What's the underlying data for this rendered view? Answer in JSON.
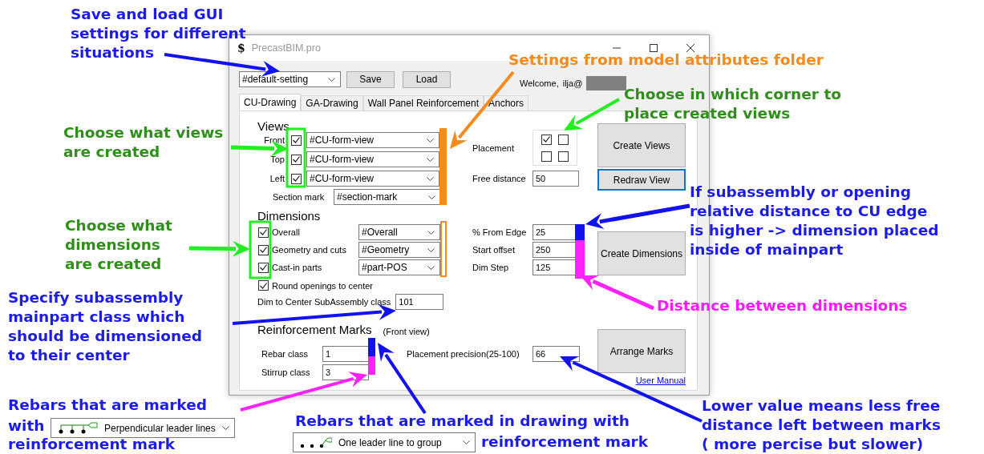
{
  "window": {
    "icon": "$",
    "title": "PrecastBIM.pro"
  },
  "toolbar": {
    "setting": "#default-setting",
    "buttons": [
      "Save",
      "Load"
    ],
    "welcome": "Welcome,",
    "user": "ilja@"
  },
  "tabs": [
    {
      "label": "CU-Drawing",
      "selected": true
    },
    {
      "label": "GA-Drawing",
      "selected": false
    },
    {
      "label": "Wall Panel Reinforcement",
      "selected": false
    },
    {
      "label": "Anchors",
      "selected": false
    }
  ],
  "views": {
    "heading": "Views",
    "rows": [
      {
        "label": "Front",
        "checked": true,
        "value": "#CU-form-view"
      },
      {
        "label": "Top",
        "checked": true,
        "value": "#CU-form-view"
      },
      {
        "label": "Left",
        "checked": true,
        "value": "#CU-form-view"
      }
    ],
    "section_mark": {
      "label": "Section mark",
      "value": "#section-mark"
    },
    "placement": {
      "label": "Placement",
      "corners": [
        {
          "checked": true
        },
        {
          "checked": false
        },
        {
          "checked": false
        },
        {
          "checked": false
        }
      ]
    },
    "free_distance": {
      "label": "Free distance",
      "value": "50"
    },
    "buttons": [
      {
        "label": "Create Views",
        "focused": false
      },
      {
        "label": "Redraw View",
        "focused": true
      }
    ]
  },
  "dimensions": {
    "heading": "Dimensions",
    "rows": [
      {
        "label": "Overall",
        "checked": true,
        "value": "#Overall"
      },
      {
        "label": "Geometry and cuts",
        "checked": true,
        "value": "#Geometry"
      },
      {
        "label": "Cast-in parts",
        "checked": true,
        "value": "#part-POS"
      }
    ],
    "round_openings": {
      "label": "Round openings to center",
      "checked": true
    },
    "dim_to_center": {
      "label": "Dim to Center SubAssembly class",
      "value": "101"
    },
    "fields": [
      {
        "label": "% From Edge",
        "value": "25"
      },
      {
        "label": "Start offset",
        "value": "250"
      },
      {
        "label": "Dim Step",
        "value": "125"
      }
    ],
    "button": "Create Dimensions"
  },
  "reinforcement": {
    "heading": "Reinforcement Marks",
    "note": "(Front view)",
    "fields": [
      {
        "label": "Rebar class",
        "value": "1"
      },
      {
        "label": "Stirrup class",
        "value": "3"
      }
    ],
    "precision": {
      "label": "Placement precision(25-100)",
      "value": "66"
    },
    "button": "Arrange Marks",
    "link": "User Manual"
  },
  "annotations": [
    {
      "kind": "text",
      "color": "#1c1ce6",
      "lines": [
        "Save and load GUI",
        "settings for different",
        "situations"
      ]
    },
    {
      "kind": "text",
      "color": "#f58a1f",
      "lines": [
        "Settings from model attributes folder"
      ]
    },
    {
      "kind": "text",
      "color": "#2f8f1a",
      "lines": [
        "Choose in which corner to",
        "place created views"
      ]
    },
    {
      "kind": "text",
      "color": "#2f8f1a",
      "lines": [
        "Choose what views",
        "are created"
      ]
    },
    {
      "kind": "text",
      "color": "#2f8f1a",
      "lines": [
        "Choose what",
        "dimensions",
        "are created"
      ]
    },
    {
      "kind": "text",
      "color": "#1c1ce6",
      "lines": [
        "If subassembly or opening",
        "relative distance to CU edge",
        "is higher -> dimension placed",
        "inside of mainpart"
      ]
    },
    {
      "kind": "text",
      "color": "#ff1aff",
      "lines": [
        "Distance between dimensions"
      ]
    },
    {
      "kind": "text",
      "color": "#1c1ce6",
      "lines": [
        "Specify subassembly",
        "mainpart class which",
        "should be dimensioned",
        "to their center"
      ]
    },
    {
      "kind": "text",
      "color": "#1c1ce6",
      "lines": [
        "Rebars that are marked"
      ]
    },
    {
      "kind": "text",
      "color": "#1c1ce6",
      "lines": [
        "with"
      ]
    },
    {
      "kind": "perpendicular",
      "label": "Perpendicular leader lines"
    },
    {
      "kind": "text",
      "color": "#1c1ce6",
      "lines": [
        "reinforcement mark"
      ]
    },
    {
      "kind": "text",
      "color": "#1c1ce6",
      "lines": [
        "Rebars that are marked in drawing with"
      ]
    },
    {
      "kind": "grouped",
      "label": "One leader line to group"
    },
    {
      "kind": "text",
      "color": "#1c1ce6",
      "lines": [
        "reinforcement mark"
      ]
    },
    {
      "kind": "text",
      "color": "#1c1ce6",
      "lines": [
        "Lower value means less free",
        "distance left between marks",
        "( more percise but slower)"
      ]
    }
  ]
}
